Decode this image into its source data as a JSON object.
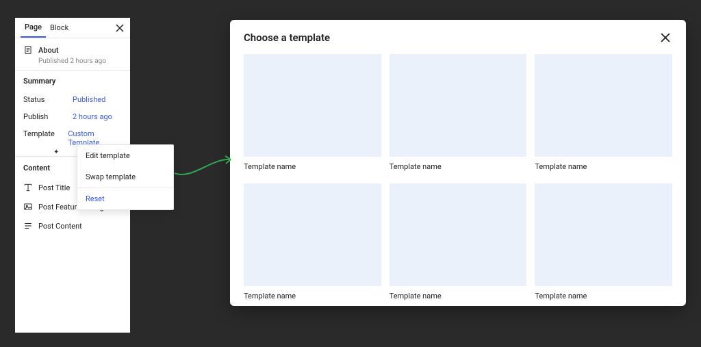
{
  "sidebar": {
    "tabs": {
      "page": "Page",
      "block": "Block"
    },
    "page_title": "About",
    "page_meta": "Published 2 hours ago",
    "summary_title": "Summary",
    "summary": {
      "status_label": "Status",
      "status_value": "Published",
      "publish_label": "Publish",
      "publish_value": "2 hours ago",
      "template_label": "Template",
      "template_value": "Custom Template"
    },
    "content_title": "Content",
    "content_items": [
      "Post Title",
      "Post Featured Image",
      "Post Content"
    ]
  },
  "popover": {
    "edit": "Edit template",
    "swap": "Swap template",
    "reset": "Reset"
  },
  "modal": {
    "title": "Choose a template",
    "templates": [
      "Template name",
      "Template name",
      "Template name",
      "Template name",
      "Template name",
      "Template name"
    ]
  },
  "colors": {
    "accent": "#3858e9",
    "thumb_bg": "#eaf1fb"
  }
}
